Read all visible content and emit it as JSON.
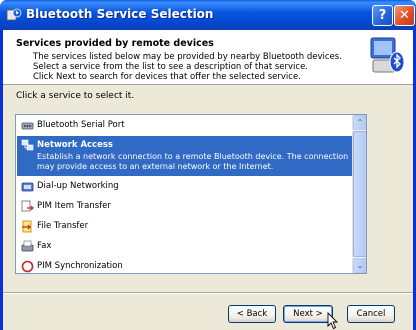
{
  "window": {
    "title": "Bluetooth Service Selection",
    "help_label": "?",
    "close_label": "✕"
  },
  "header": {
    "title": "Services provided by remote devices",
    "lines": [
      "The services listed below may be provided by nearby Bluetooth devices.",
      "Select a service from the list to see a description of that service.",
      "Click Next to search for devices that offer the selected service."
    ]
  },
  "prompt": "Click a service to select it.",
  "services": [
    {
      "label": "Bluetooth Serial Port",
      "icon": "serial-port-icon"
    },
    {
      "label": "Network Access",
      "icon": "network-icon",
      "selected": true,
      "description": [
        "Establish a network connection to a remote Bluetooth device. The connection",
        "may provide access to an external network or the Internet."
      ]
    },
    {
      "label": "Dial-up Networking",
      "icon": "dialup-icon"
    },
    {
      "label": "PIM Item Transfer",
      "icon": "pim-transfer-icon"
    },
    {
      "label": "File Transfer",
      "icon": "file-transfer-icon"
    },
    {
      "label": "Fax",
      "icon": "fax-icon"
    },
    {
      "label": "PIM Synchronization",
      "icon": "pim-sync-icon"
    }
  ],
  "scrollbar": {
    "up": "⌃",
    "down": "⌄"
  },
  "buttons": {
    "back": "< Back",
    "next": "Next >",
    "cancel": "Cancel"
  },
  "colors": {
    "titlebar": "#0a58e0",
    "selection": "#316ac5",
    "dialog_bg": "#ece9d8"
  }
}
